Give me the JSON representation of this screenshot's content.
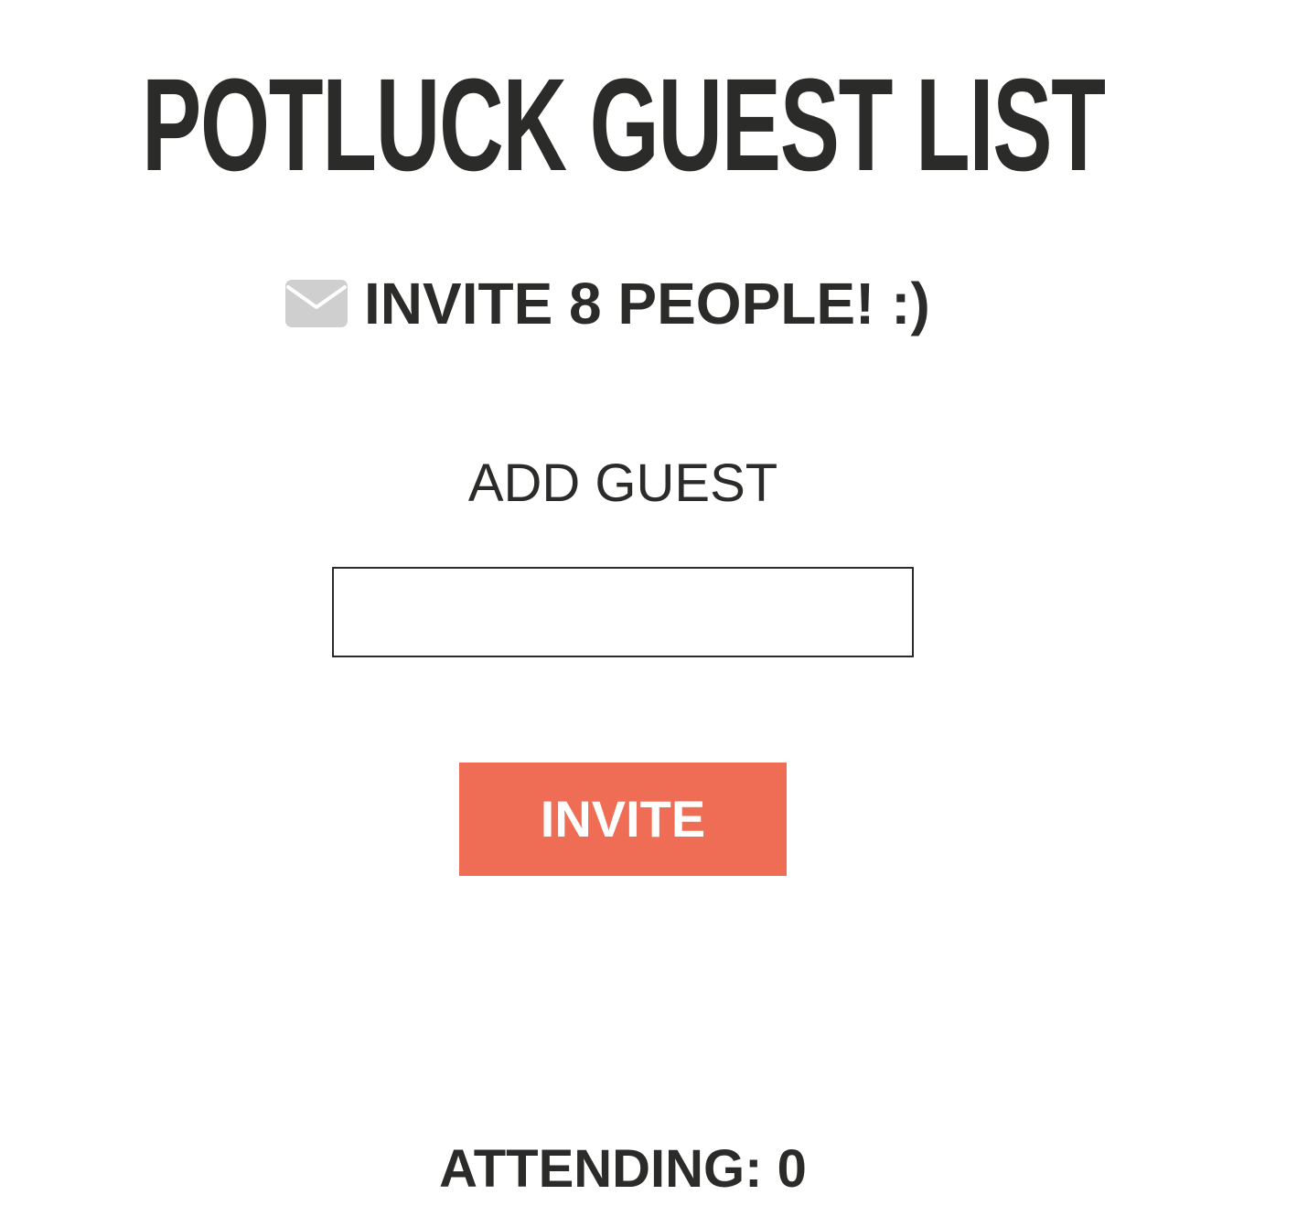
{
  "header": {
    "title": "POTLUCK GUEST LIST"
  },
  "invite_banner": {
    "icon": "envelope-icon",
    "icon_color": "#cfcfcf",
    "text": "INVITE 8 PEOPLE! :)"
  },
  "add_guest": {
    "label": "ADD GUEST",
    "input_value": "",
    "input_placeholder": ""
  },
  "invite_button": {
    "label": "INVITE",
    "color": "#ef6c55"
  },
  "attending": {
    "text": "ATTENDING: 0"
  },
  "colors": {
    "text": "#2b2b29",
    "background": "#ffffff"
  }
}
